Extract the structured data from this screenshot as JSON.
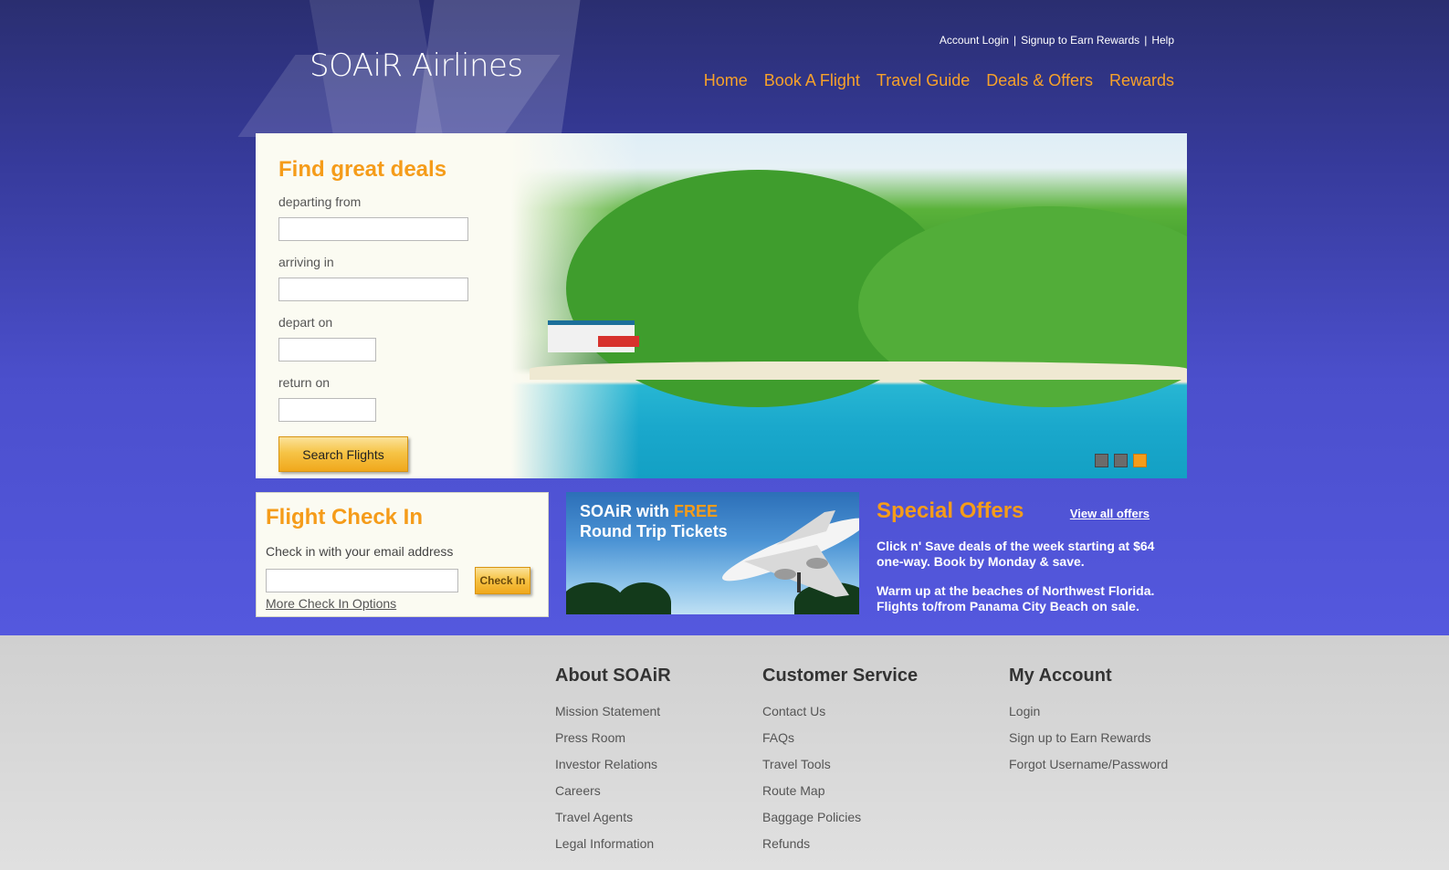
{
  "brand": {
    "logo_text": "SOAiR Airlines"
  },
  "utility_links": [
    "Account Login",
    "Signup to Earn Rewards",
    "Help"
  ],
  "utility_separator": "|",
  "nav": [
    "Home",
    "Book A Flight",
    "Travel Guide",
    "Deals & Offers",
    "Rewards"
  ],
  "deals": {
    "title": "Find great deals",
    "departing_label": "departing from",
    "departing_value": "",
    "arriving_label": "arriving in",
    "arriving_value": "",
    "depart_label": "depart on",
    "depart_value": "",
    "return_label": "return on",
    "return_value": "",
    "search_button": "Search Flights"
  },
  "slider": {
    "count": 3,
    "active_index": 3
  },
  "checkin": {
    "title": "Flight Check In",
    "hint": "Check in with your email address",
    "email_value": "",
    "button": "Check In",
    "more_link": "More Check In Options"
  },
  "promo": {
    "line1_prefix": "SOAiR with ",
    "line1_highlight": "FREE",
    "line2": "Round Trip Tickets"
  },
  "offers": {
    "title": "Special Offers",
    "view_all": "View all offers",
    "items": [
      "Click n' Save deals of the week starting at $64 one-way. Book by Monday & save.",
      "Warm up at the beaches of Northwest Florida. Flights to/from Panama City Beach on sale."
    ]
  },
  "footer": {
    "about": {
      "title": "About SOAiR",
      "links": [
        "Mission Statement",
        "Press Room",
        "Investor Relations",
        "Careers",
        "Travel Agents",
        "Legal Information"
      ]
    },
    "service": {
      "title": "Customer Service",
      "links": [
        "Contact Us",
        "FAQs",
        "Travel Tools",
        "Route Map",
        "Baggage Policies",
        "Refunds"
      ]
    },
    "account": {
      "title": "My Account",
      "links": [
        "Login",
        "Sign up to Earn Rewards",
        "Forgot Username/Password"
      ]
    }
  },
  "colors": {
    "accent": "#f59c1a",
    "header_top": "#2a2e70",
    "header_bottom": "#5458de",
    "footer": "#d8d8d8"
  },
  "icons": [
    "slider-dot",
    "plane-graphic"
  ]
}
